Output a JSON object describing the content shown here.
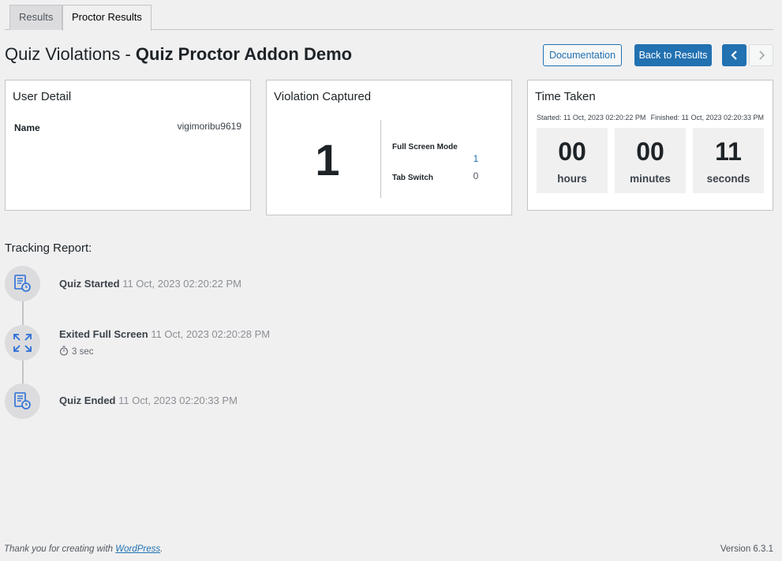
{
  "tabs": [
    {
      "label": "Results",
      "active": false
    },
    {
      "label": "Proctor Results",
      "active": true
    }
  ],
  "header": {
    "title_prefix": "Quiz Violations - ",
    "title_quiz": "Quiz Proctor Addon Demo",
    "documentation_label": "Documentation",
    "back_label": "Back to Results",
    "prev_icon": "chevron-left-icon",
    "next_icon": "chevron-right-icon"
  },
  "user_detail": {
    "title": "User Detail",
    "name_label": "Name",
    "name_value": "vigimoribu9619"
  },
  "violations": {
    "title": "Violation Captured",
    "total": "1",
    "items": [
      {
        "label": "Full Screen Mode",
        "value": "1"
      },
      {
        "label": "Tab Switch",
        "value": "0"
      }
    ]
  },
  "time_taken": {
    "title": "Time Taken",
    "started": "Started: 11 Oct, 2023 02:20:22 PM",
    "finished": "Finished: 11 Oct, 2023 02:20:33 PM",
    "units": [
      {
        "value": "00",
        "label": "hours"
      },
      {
        "value": "00",
        "label": "minutes"
      },
      {
        "value": "11",
        "label": "seconds"
      }
    ]
  },
  "tracking": {
    "title": "Tracking Report:",
    "events": [
      {
        "title": "Quiz Started",
        "time": "11 Oct, 2023 02:20:22 PM",
        "icon": "quiz-clock-icon"
      },
      {
        "title": "Exited Full Screen",
        "time": "11 Oct, 2023 02:20:28 PM",
        "icon": "fullscreen-expand-icon",
        "duration": "3 sec"
      },
      {
        "title": "Quiz Ended",
        "time": "11 Oct, 2023 02:20:33 PM",
        "icon": "quiz-clock-icon"
      }
    ]
  },
  "footer": {
    "thanks_prefix": "Thank you for creating with ",
    "wordpress_link": "WordPress",
    "thanks_suffix": ".",
    "version": "Version 6.3.1"
  },
  "colors": {
    "accent": "#2271b1",
    "background": "#f0f0f1",
    "icon_blue": "#2b6fd6"
  }
}
